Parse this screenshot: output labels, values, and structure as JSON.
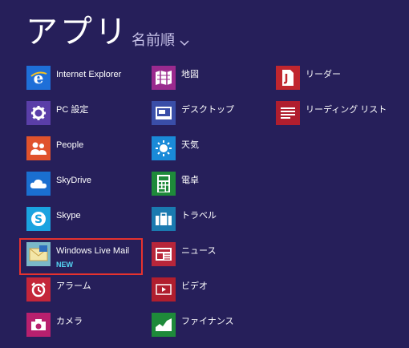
{
  "header": {
    "title": "アプリ",
    "sort_label": "名前順"
  },
  "colors": {
    "background": "#261f5a",
    "highlight_border": "#e6322e",
    "new_badge": "#56d8f5"
  },
  "columns": [
    {
      "items": [
        {
          "label": "Internet Explorer",
          "icon": "internet-explorer-icon",
          "tile_color": "#1e6fd8"
        },
        {
          "label": "PC 設定",
          "icon": "gear-icon",
          "tile_color": "#5a3ea8"
        },
        {
          "label": "People",
          "icon": "people-icon",
          "tile_color": "#e0522c"
        },
        {
          "label": "SkyDrive",
          "icon": "cloud-icon",
          "tile_color": "#1a6fd0"
        },
        {
          "label": "Skype",
          "icon": "skype-icon",
          "tile_color": "#1aa3e0"
        },
        {
          "label": "Windows Live Mail",
          "sub": "NEW",
          "icon": "mail-icon",
          "tile_color": "#3a8a5a"
        },
        {
          "label": "アラーム",
          "icon": "alarm-icon",
          "tile_color": "#c4263a"
        },
        {
          "label": "カメラ",
          "icon": "camera-icon",
          "tile_color": "#b8206e"
        }
      ]
    },
    {
      "items": [
        {
          "label": "地図",
          "icon": "map-icon",
          "tile_color": "#9a2a8e"
        },
        {
          "label": "デスクトップ",
          "icon": "desktop-icon",
          "tile_color": "#3a4ea8"
        },
        {
          "label": "天気",
          "icon": "sun-icon",
          "tile_color": "#1a8ad8"
        },
        {
          "label": "電卓",
          "icon": "calculator-icon",
          "tile_color": "#1e8a3a"
        },
        {
          "label": "トラベル",
          "icon": "suitcase-icon",
          "tile_color": "#1a7ab0"
        },
        {
          "label": "ニュース",
          "icon": "news-icon",
          "tile_color": "#b8263a"
        },
        {
          "label": "ビデオ",
          "icon": "video-icon",
          "tile_color": "#b01e2e"
        },
        {
          "label": "ファイナンス",
          "icon": "finance-icon",
          "tile_color": "#1e8a3a"
        }
      ]
    },
    {
      "items": [
        {
          "label": "リーダー",
          "icon": "reader-icon",
          "tile_color": "#c0262e"
        },
        {
          "label": "リーディング リスト",
          "icon": "reading-list-icon",
          "tile_color": "#b01e2e"
        }
      ]
    }
  ]
}
